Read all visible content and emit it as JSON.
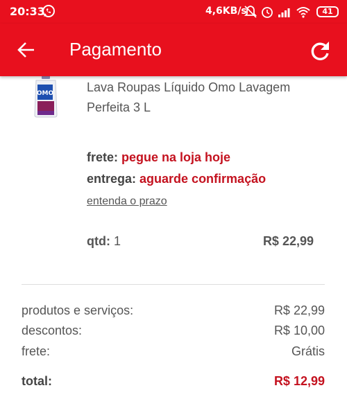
{
  "status_bar": {
    "time": "20:33",
    "network_speed": "4,6KB/s",
    "battery": "41"
  },
  "header": {
    "title": "Pagamento"
  },
  "product": {
    "name": "Lava Roupas Líquido Omo Lavagem Perfeita 3 L",
    "frete_label": "frete:",
    "frete_value": "pegue na loja hoje",
    "entrega_label": "entrega:",
    "entrega_value": "aguarde confirmação",
    "prazo_link": "entenda o prazo",
    "qtd_label": "qtd:",
    "qtd_value": "1",
    "price": "R$ 22,99"
  },
  "summary": {
    "products_label": "produtos e serviços:",
    "products_value": "R$ 22,99",
    "discounts_label": "descontos:",
    "discounts_value": "R$ 10,00",
    "shipping_label": "frete:",
    "shipping_value": "Grátis",
    "total_label": "total:",
    "total_value": "R$ 12,99"
  },
  "colors": {
    "brand_red": "#e8101e",
    "accent_red": "#c4121f"
  }
}
